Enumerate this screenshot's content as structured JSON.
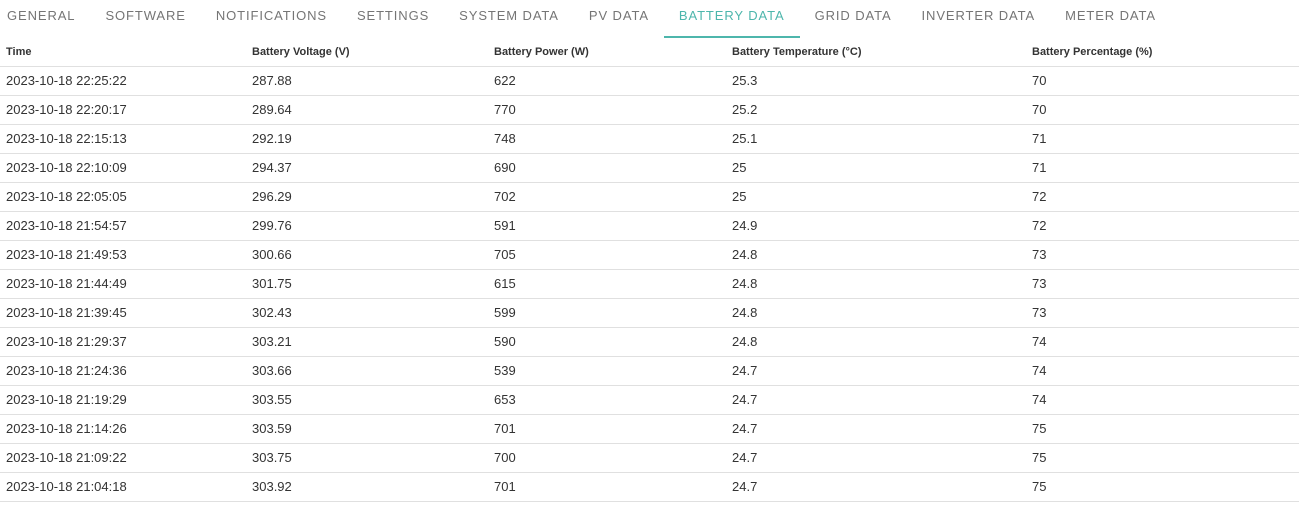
{
  "colors": {
    "accent": "#4db6ac",
    "tab_text": "#757575",
    "divider": "#e0e0e0"
  },
  "tabs": [
    {
      "label": "GENERAL",
      "active": false
    },
    {
      "label": "SOFTWARE",
      "active": false
    },
    {
      "label": "NOTIFICATIONS",
      "active": false
    },
    {
      "label": "SETTINGS",
      "active": false
    },
    {
      "label": "SYSTEM DATA",
      "active": false
    },
    {
      "label": "PV DATA",
      "active": false
    },
    {
      "label": "BATTERY DATA",
      "active": true
    },
    {
      "label": "GRID DATA",
      "active": false
    },
    {
      "label": "INVERTER DATA",
      "active": false
    },
    {
      "label": "METER DATA",
      "active": false
    }
  ],
  "table": {
    "headers": [
      "Time",
      "Battery Voltage (V)",
      "Battery Power (W)",
      "Battery Temperature (°C)",
      "Battery Percentage (%)"
    ],
    "rows": [
      [
        "2023-10-18 22:25:22",
        "287.88",
        "622",
        "25.3",
        "70"
      ],
      [
        "2023-10-18 22:20:17",
        "289.64",
        "770",
        "25.2",
        "70"
      ],
      [
        "2023-10-18 22:15:13",
        "292.19",
        "748",
        "25.1",
        "71"
      ],
      [
        "2023-10-18 22:10:09",
        "294.37",
        "690",
        "25",
        "71"
      ],
      [
        "2023-10-18 22:05:05",
        "296.29",
        "702",
        "25",
        "72"
      ],
      [
        "2023-10-18 21:54:57",
        "299.76",
        "591",
        "24.9",
        "72"
      ],
      [
        "2023-10-18 21:49:53",
        "300.66",
        "705",
        "24.8",
        "73"
      ],
      [
        "2023-10-18 21:44:49",
        "301.75",
        "615",
        "24.8",
        "73"
      ],
      [
        "2023-10-18 21:39:45",
        "302.43",
        "599",
        "24.8",
        "73"
      ],
      [
        "2023-10-18 21:29:37",
        "303.21",
        "590",
        "24.8",
        "74"
      ],
      [
        "2023-10-18 21:24:36",
        "303.66",
        "539",
        "24.7",
        "74"
      ],
      [
        "2023-10-18 21:19:29",
        "303.55",
        "653",
        "24.7",
        "74"
      ],
      [
        "2023-10-18 21:14:26",
        "303.59",
        "701",
        "24.7",
        "75"
      ],
      [
        "2023-10-18 21:09:22",
        "303.75",
        "700",
        "24.7",
        "75"
      ],
      [
        "2023-10-18 21:04:18",
        "303.92",
        "701",
        "24.7",
        "75"
      ]
    ]
  }
}
